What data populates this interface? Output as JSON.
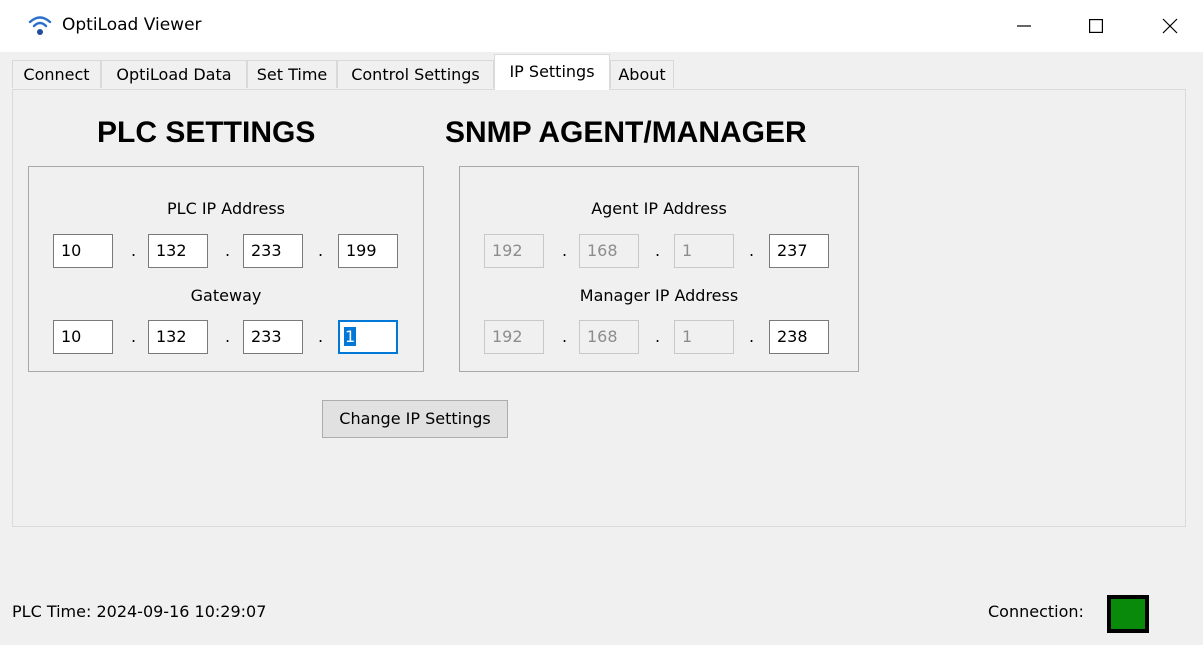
{
  "window": {
    "title": "OptiLoad Viewer",
    "icon": "wifi-icon",
    "controls": {
      "minimize": "minimize-icon",
      "maximize": "maximize-icon",
      "close": "close-icon"
    }
  },
  "tabs": [
    {
      "label": "Connect",
      "active": false
    },
    {
      "label": "OptiLoad Data",
      "active": false
    },
    {
      "label": "Set Time",
      "active": false
    },
    {
      "label": "Control Settings",
      "active": false
    },
    {
      "label": "IP Settings",
      "active": true
    },
    {
      "label": "About",
      "active": false
    }
  ],
  "plc": {
    "heading": "PLC SETTINGS",
    "ip_label": "PLC IP Address",
    "ip": [
      "10",
      "132",
      "233",
      "199"
    ],
    "gateway_label": "Gateway",
    "gateway": [
      "10",
      "132",
      "233",
      "1"
    ]
  },
  "snmp": {
    "heading": "SNMP AGENT/MANAGER",
    "agent_label": "Agent IP Address",
    "agent": [
      "192",
      "168",
      "1",
      "237"
    ],
    "manager_label": "Manager IP Address",
    "manager": [
      "192",
      "168",
      "1",
      "238"
    ]
  },
  "separator": ".",
  "change_button": "Change IP Settings",
  "status": {
    "plc_time": "PLC Time: 2024-09-16 10:29:07",
    "connection_label": "Connection:",
    "connection_color": "#0a8a0a"
  },
  "colors": {
    "accent": "#0078d7",
    "form_bg": "#f0f0f0"
  }
}
